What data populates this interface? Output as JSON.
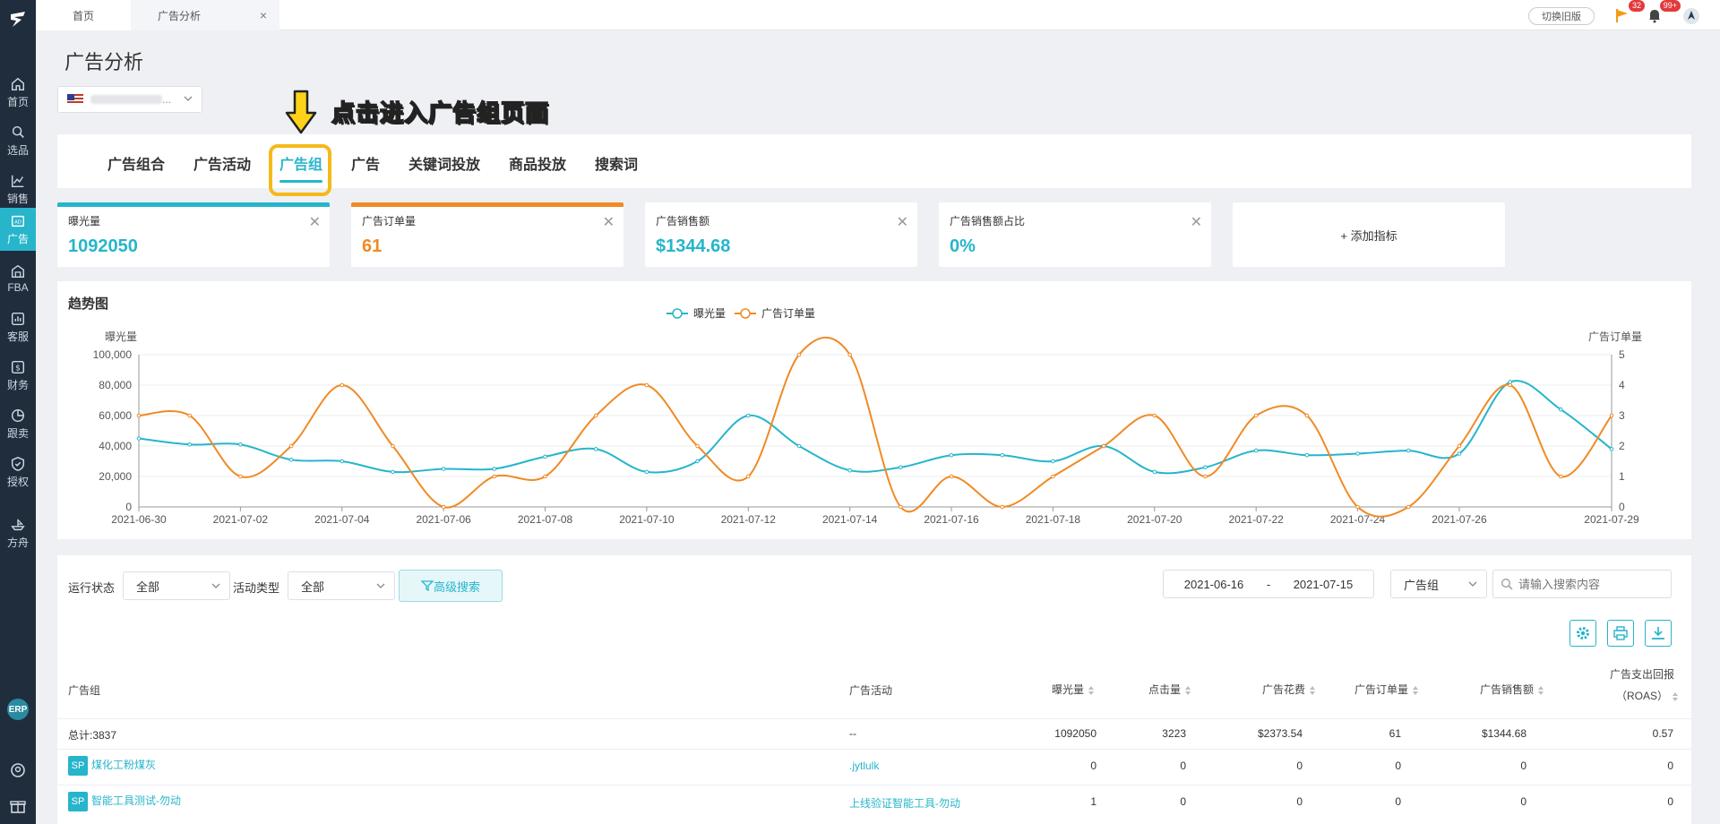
{
  "leftnav": {
    "items": [
      {
        "label": "首页",
        "icon": "home-icon"
      },
      {
        "label": "选品",
        "icon": "search-icon"
      },
      {
        "label": "销售",
        "icon": "trend-icon"
      },
      {
        "label": "广告",
        "icon": "ad-icon"
      },
      {
        "label": "FBA",
        "icon": "warehouse-icon"
      },
      {
        "label": "客服",
        "icon": "service-icon"
      },
      {
        "label": "财务",
        "icon": "finance-icon"
      },
      {
        "label": "跟卖",
        "icon": "follow-icon"
      },
      {
        "label": "授权",
        "icon": "auth-icon"
      },
      {
        "label": "方舟",
        "icon": "ark-icon"
      }
    ],
    "erp": "ERP"
  },
  "topbar": {
    "home_tab": "首页",
    "current_tab": "广告分析",
    "close": "×",
    "switch_old": "切换旧版",
    "flag_badge": "32",
    "bell_badge": "99+"
  },
  "page": {
    "title": "广告分析",
    "store_value": "..."
  },
  "annotation": {
    "text": "点击进入广告组页面"
  },
  "subtabs": [
    "广告组合",
    "广告活动",
    "广告组",
    "广告",
    "关键词投放",
    "商品投放",
    "搜索词"
  ],
  "metrics": [
    {
      "label": "曝光量",
      "value": "1092050",
      "color": "#26b5cb"
    },
    {
      "label": "广告订单量",
      "value": "61",
      "color": "#f08a24"
    },
    {
      "label": "广告销售额",
      "value": "$1344.68",
      "color": "#26b5cb"
    },
    {
      "label": "广告销售额占比",
      "value": "0%",
      "color": "#26b5cb"
    }
  ],
  "add_metric": "+ 添加指标",
  "chart_data": {
    "type": "line",
    "title": "趋势图",
    "x": [
      "2021-06-30",
      "2021-07-01",
      "2021-07-02",
      "2021-07-03",
      "2021-07-04",
      "2021-07-05",
      "2021-07-06",
      "2021-07-07",
      "2021-07-08",
      "2021-07-09",
      "2021-07-10",
      "2021-07-11",
      "2021-07-12",
      "2021-07-13",
      "2021-07-14",
      "2021-07-15",
      "2021-07-16",
      "2021-07-17",
      "2021-07-18",
      "2021-07-19",
      "2021-07-20",
      "2021-07-21",
      "2021-07-22",
      "2021-07-23",
      "2021-07-24",
      "2021-07-25",
      "2021-07-26",
      "2021-07-27",
      "2021-07-28",
      "2021-07-29"
    ],
    "x_ticks": [
      "2021-06-30",
      "2021-07-02",
      "2021-07-04",
      "2021-07-06",
      "2021-07-08",
      "2021-07-10",
      "2021-07-12",
      "2021-07-14",
      "2021-07-16",
      "2021-07-18",
      "2021-07-20",
      "2021-07-22",
      "2021-07-24",
      "2021-07-26",
      "2021-07-29"
    ],
    "series": [
      {
        "name": "曝光量",
        "axis": "left",
        "color": "#26b5cb",
        "values": [
          45000,
          41000,
          41000,
          31000,
          30000,
          23000,
          25000,
          25000,
          33000,
          38000,
          23000,
          30000,
          60000,
          40000,
          24000,
          26000,
          34000,
          34000,
          30000,
          40000,
          23000,
          26000,
          37000,
          34000,
          35000,
          37000,
          35000,
          82000,
          64000,
          38000
        ]
      },
      {
        "name": "广告订单量",
        "axis": "right",
        "color": "#f08a24",
        "values": [
          3,
          3,
          1,
          2,
          4,
          2,
          0,
          1,
          1,
          3,
          4,
          2,
          1,
          5,
          5,
          0,
          1,
          0,
          1,
          2,
          3,
          1,
          3,
          3,
          0,
          0,
          2,
          4,
          1,
          3
        ]
      }
    ],
    "ylabel_left": "曝光量",
    "ylabel_right": "广告订单量",
    "ylim_left": [
      0,
      100000
    ],
    "ylim_right": [
      0,
      5
    ],
    "yticks_left": [
      "0",
      "20,000",
      "40,000",
      "60,000",
      "80,000",
      "100,000"
    ],
    "yticks_right": [
      "0",
      "1",
      "2",
      "3",
      "4",
      "5"
    ],
    "legend": "top-center",
    "grid": true
  },
  "filters": {
    "status_label": "运行状态",
    "status_value": "全部",
    "type_label": "活动类型",
    "type_value": "全部",
    "advanced": "高级搜索",
    "date_start": "2021-06-16",
    "date_sep": "-",
    "date_end": "2021-07-15",
    "scope_value": "广告组",
    "search_placeholder": "请输入搜索内容"
  },
  "table": {
    "headers": [
      "广告组",
      "广告活动",
      "曝光量",
      "点击量",
      "广告花费",
      "广告订单量",
      "广告销售额",
      "广告支出回报",
      "（ROAS）"
    ],
    "total": {
      "name": "总计:3837",
      "campaign": "--",
      "impressions": "1092050",
      "clicks": "3223",
      "spend": "$2373.54",
      "orders": "61",
      "sales": "$1344.68",
      "roas": "0.57"
    },
    "rows": [
      {
        "tag": "SP",
        "name": "煤化工粉煤灰",
        "campaign": ".jytlulk",
        "impressions": "0",
        "clicks": "0",
        "spend": "0",
        "orders": "0",
        "sales": "0",
        "roas": "0"
      },
      {
        "tag": "SP",
        "name": "智能工具测试-勿动",
        "campaign": "上线验证智能工具-勿动",
        "impressions": "1",
        "clicks": "0",
        "spend": "0",
        "orders": "0",
        "sales": "0",
        "roas": "0"
      }
    ]
  }
}
